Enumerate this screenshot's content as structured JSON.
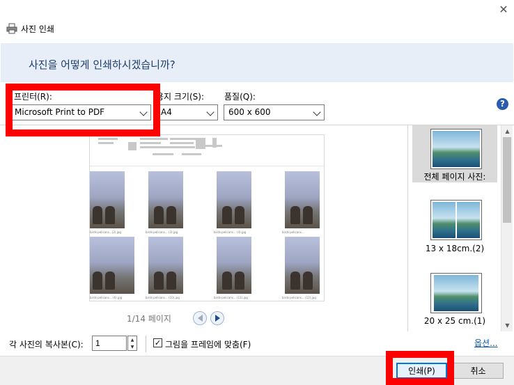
{
  "window": {
    "title": "사진 인쇄",
    "close_glyph": "✕"
  },
  "banner": {
    "heading": "사진을 어떻게 인쇄하시겠습니까?"
  },
  "printer": {
    "label": "프린터(R):",
    "value": "Microsoft Print to PDF"
  },
  "paper_size": {
    "label": "용지 크기(S):",
    "value": "A4"
  },
  "quality": {
    "label": "품질(Q):",
    "value": "600 x 600"
  },
  "help": {
    "glyph": "?"
  },
  "preview": {
    "page_indicator": "1/14 페이지",
    "thumb_captions": [
      "birds-pelicans…(2).jpg",
      "birds-pelicans… (3).jpg",
      "birds-pelicans… (4).jpg",
      "birds-pelicans…",
      "birds-pelicans… (6).jpg",
      "birds-pelicans… (10).jpg",
      "birds-pelicans… (11).jpg",
      "birds-pelicans… (12).jpg"
    ]
  },
  "layouts": [
    {
      "label": "전체 페이지 사진:",
      "selected": true
    },
    {
      "label": "13 x 18cm.(2)",
      "selected": false
    },
    {
      "label": "20 x 25 cm.(1)",
      "selected": false
    }
  ],
  "copies": {
    "label": "각 사진의 복사본(C):",
    "value": "1"
  },
  "fit_to_frame": {
    "label": "그림을 프레임에 맞춤(F)",
    "checked": true,
    "check_glyph": "✓"
  },
  "options_link": "옵션...",
  "buttons": {
    "print": "인쇄(P)",
    "cancel": "취소"
  },
  "annotation_color": "#ff0000"
}
